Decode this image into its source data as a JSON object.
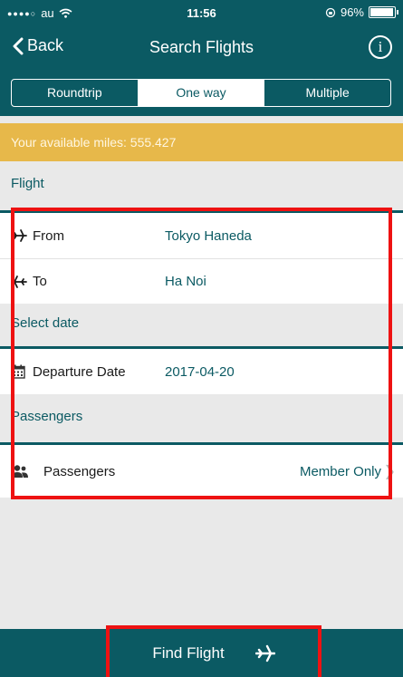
{
  "status_bar": {
    "carrier": "au",
    "time": "11:56",
    "battery_percent_text": "96%",
    "battery_level": 0.96
  },
  "nav": {
    "back_label": "Back",
    "title": "Search Flights",
    "info_glyph": "i"
  },
  "trip_types": {
    "options": [
      "Roundtrip",
      "One way",
      "Multiple"
    ],
    "selected": "One way"
  },
  "miles_banner": "Your available miles: 555.427",
  "sections": {
    "flight": "Flight",
    "select_date": "Select date",
    "passengers": "Passengers"
  },
  "flight": {
    "from_label": "From",
    "from_value": "Tokyo Haneda",
    "to_label": "To",
    "to_value": "Ha Noi"
  },
  "date": {
    "label": "Departure Date",
    "value": "2017-04-20"
  },
  "passengers": {
    "label": "Passengers",
    "value": "Member Only"
  },
  "find_flight": "Find Flight",
  "icons": {
    "back": "chevron-left-icon",
    "info": "info-icon",
    "from": "plane-departure-icon",
    "to": "plane-arrival-icon",
    "date": "calendar-icon",
    "passengers": "users-icon",
    "chevron": "chevron-right-icon",
    "find": "plane-icon"
  },
  "colors": {
    "brand_teal": "#0b5a63",
    "miles_banner": "#e7b84a",
    "highlight": "#ee1212"
  }
}
